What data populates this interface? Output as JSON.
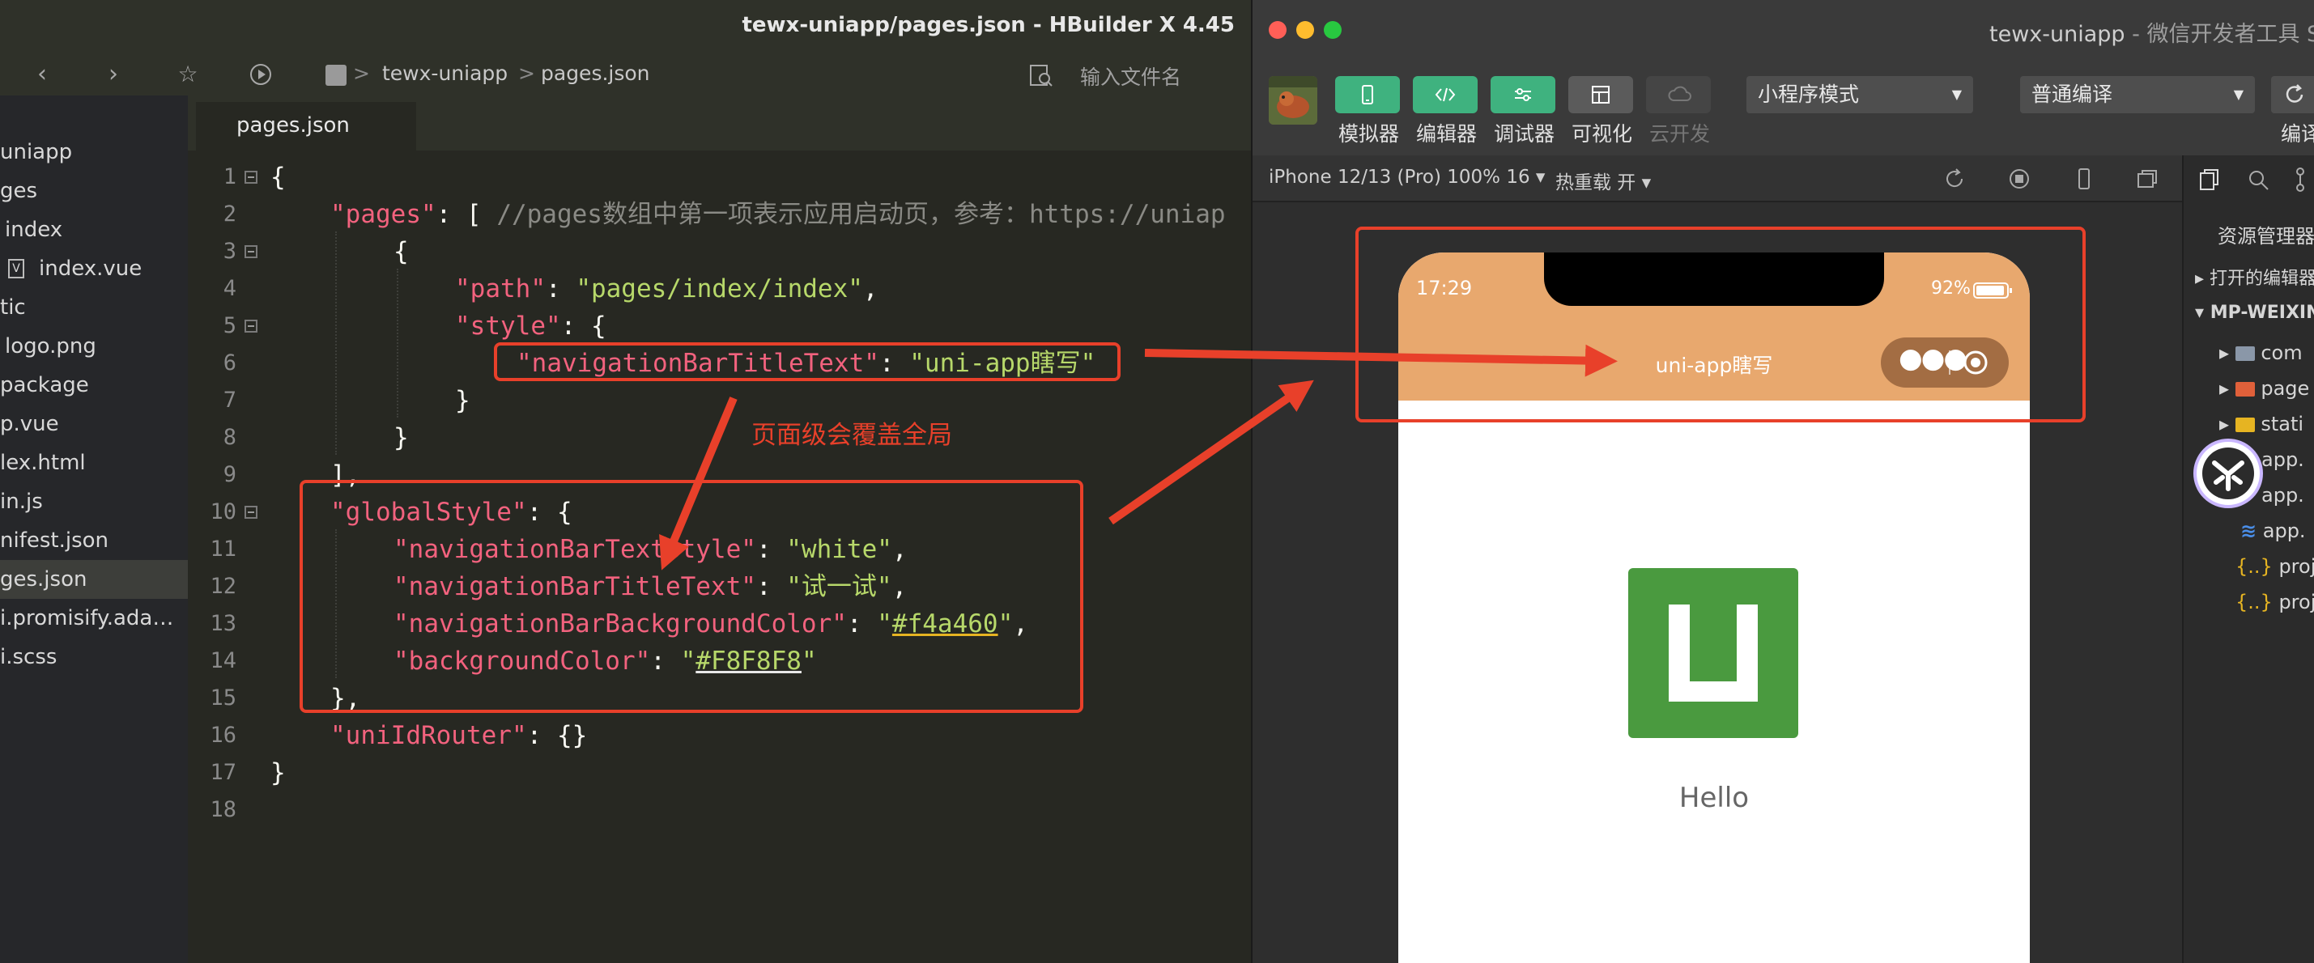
{
  "hbuilder": {
    "title": "tewx-uniapp/pages.json - HBuilder X 4.45",
    "breadcrumb": {
      "project": "tewx-uniapp",
      "separator": ">",
      "file": "pages.json"
    },
    "search_placeholder": "输入文件名",
    "tab": "pages.json",
    "tree": [
      "uniapp",
      "ges",
      "index",
      "index.vue",
      "tic",
      "logo.png",
      "package",
      "p.vue",
      "lex.html",
      "in.js",
      "nifest.json",
      "ges.json",
      "i.promisify.ada…",
      "i.scss"
    ],
    "line_numbers": [
      "1",
      "2",
      "3",
      "4",
      "5",
      "6",
      "7",
      "8",
      "9",
      "10",
      "11",
      "12",
      "13",
      "14",
      "15",
      "16",
      "17",
      "18"
    ],
    "code": {
      "l1": "{",
      "l2_key": "\"pages\"",
      "l2_rest": ": [ ",
      "l2_comment": "//pages数组中第一项表示应用启动页，参考：https://uniap",
      "l3": "{",
      "l4_key": "\"path\"",
      "l4_colon": ": ",
      "l4_val": "\"pages/index/index\"",
      "l4_end": ",",
      "l5_key": "\"style\"",
      "l5_rest": ": {",
      "l6_key": "\"navigationBarTitleText\"",
      "l6_colon": ": ",
      "l6_val": "\"uni-app瞎写\"",
      "l7": "}",
      "l8": "}",
      "l9": "],",
      "l10_key": "\"globalStyle\"",
      "l10_rest": ": {",
      "l11_key": "\"navigationBarTextStyle\"",
      "l11_colon": ": ",
      "l11_val": "\"white\"",
      "l11_end": ",",
      "l12_key": "\"navigationBarTitleText\"",
      "l12_colon": ": ",
      "l12_val": "\"试一试\"",
      "l12_end": ",",
      "l13_key": "\"navigationBarBackgroundColor\"",
      "l13_colon": ": ",
      "l13_q1": "\"",
      "l13_val": "#f4a460",
      "l13_q2": "\"",
      "l13_end": ",",
      "l14_key": "\"backgroundColor\"",
      "l14_colon": ": ",
      "l14_q1": "\"",
      "l14_val": "#F8F8F8",
      "l14_q2": "\"",
      "l15": "},",
      "l16_key": "\"uniIdRouter\"",
      "l16_rest": ": {}",
      "l17": "}"
    }
  },
  "annotation": {
    "note": "页面级会覆盖全局"
  },
  "wechat": {
    "title_main": "tewx-uniapp",
    "title_rest": " - 微信开发者工具 Stab",
    "toolbar_buttons": [
      "模拟器",
      "编辑器",
      "调试器",
      "可视化",
      "云开发"
    ],
    "mode_select": "小程序模式",
    "compile_select": "普通编译",
    "compile_label": "编译",
    "device": "iPhone 12/13 (Pro) 100% 16 ▾",
    "hot_reload": "热重载 开 ▾",
    "phone": {
      "time": "17:29",
      "battery": "92%",
      "nav_title": "uni-app瞎写",
      "hello": "Hello",
      "nav_color": "#e8a86e"
    },
    "panel": {
      "title": "资源管理器",
      "open_editors": "打开的编辑器",
      "project": "MP-WEIXIN",
      "items": [
        "com",
        "page",
        "stati",
        "app.",
        "app.",
        "app.",
        "proje",
        "proje"
      ]
    }
  },
  "colors": {
    "annotation_red": "#e8402a",
    "green_button": "#3fb27f",
    "uni_logo_green": "#4a9a3f"
  }
}
